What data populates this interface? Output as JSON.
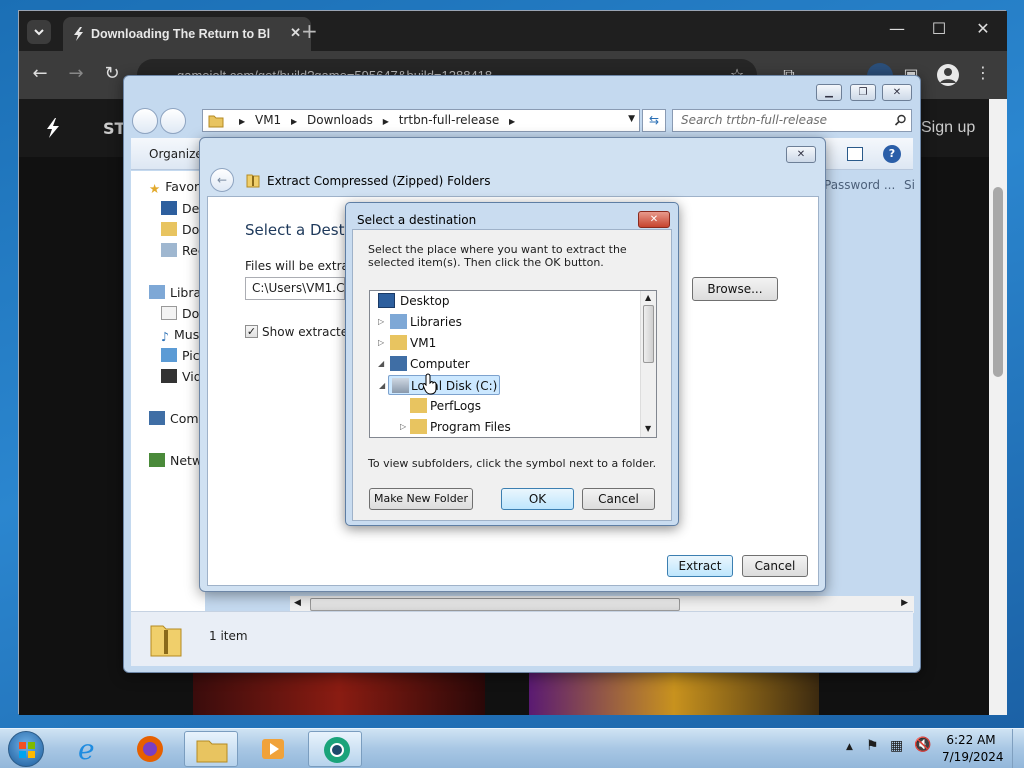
{
  "browser": {
    "tab_title": "Downloading The Return to Bl",
    "new_tab": "+",
    "url": "gamejolt.com/get/build?game=595647&build=1288418",
    "site_logo_text": "ST",
    "sign_up": "Sign up"
  },
  "explorer": {
    "breadcrumb": [
      "VM1",
      "Downloads",
      "trtbn-full-release"
    ],
    "search_placeholder": "Search trtbn-full-release",
    "organize": "Organize",
    "columns_partial": [
      "Password ...",
      "Si"
    ],
    "nav_items": [
      {
        "label": "Favorites",
        "icon": "star-icon"
      },
      {
        "label": "Desktop",
        "icon": "desktop-icon"
      },
      {
        "label": "Downloads",
        "icon": "downloads-icon"
      },
      {
        "label": "Recent Places",
        "icon": "recent-icon"
      },
      {
        "label": "Libraries",
        "icon": "library-icon"
      },
      {
        "label": "Documents",
        "icon": "documents-icon"
      },
      {
        "label": "Music",
        "icon": "music-icon"
      },
      {
        "label": "Pictures",
        "icon": "pictures-icon"
      },
      {
        "label": "Videos",
        "icon": "videos-icon"
      },
      {
        "label": "Computer",
        "icon": "computer-icon"
      },
      {
        "label": "Network",
        "icon": "network-icon"
      }
    ],
    "status_count": "1 item"
  },
  "wizard": {
    "title": "Extract Compressed (Zipped) Folders",
    "heading": "Select a Destination and Extract Files",
    "files_label": "Files will be extracted to this folder:",
    "path_value": "C:\\Users\\VM1.COMPUTER\\Downloads\\trtbn-full-release",
    "browse": "Browse...",
    "show_extracted": "Show extracted files when complete",
    "show_extracted_checked": true,
    "extract": "Extract",
    "cancel": "Cancel"
  },
  "dest_dialog": {
    "title": "Select a destination",
    "close": "✕",
    "instructions": "Select the place where you want to extract the selected item(s).  Then click the OK button.",
    "tree": [
      {
        "label": "Desktop",
        "icon": "desktop-icon",
        "toggle": ""
      },
      {
        "label": "Libraries",
        "icon": "library-icon",
        "toggle": "▷"
      },
      {
        "label": "VM1",
        "icon": "user-folder-icon",
        "toggle": "▷"
      },
      {
        "label": "Computer",
        "icon": "computer-icon",
        "toggle": "◢"
      },
      {
        "label": "Local Disk (C:)",
        "icon": "drive-icon",
        "toggle": "◢",
        "selected": true
      },
      {
        "label": "PerfLogs",
        "icon": "folder-icon",
        "toggle": ""
      },
      {
        "label": "Program Files",
        "icon": "folder-icon",
        "toggle": "▷"
      }
    ],
    "hint": "To view subfolders, click the symbol next to a folder.",
    "make_new_folder": "Make New Folder",
    "ok": "OK",
    "cancel": "Cancel"
  },
  "taskbar": {
    "time": "6:22 AM",
    "date": "7/19/2024"
  },
  "colors": {
    "selection": "#cce8ff",
    "title_text": "#1e395b",
    "link_blue": "#1e5b9c"
  }
}
